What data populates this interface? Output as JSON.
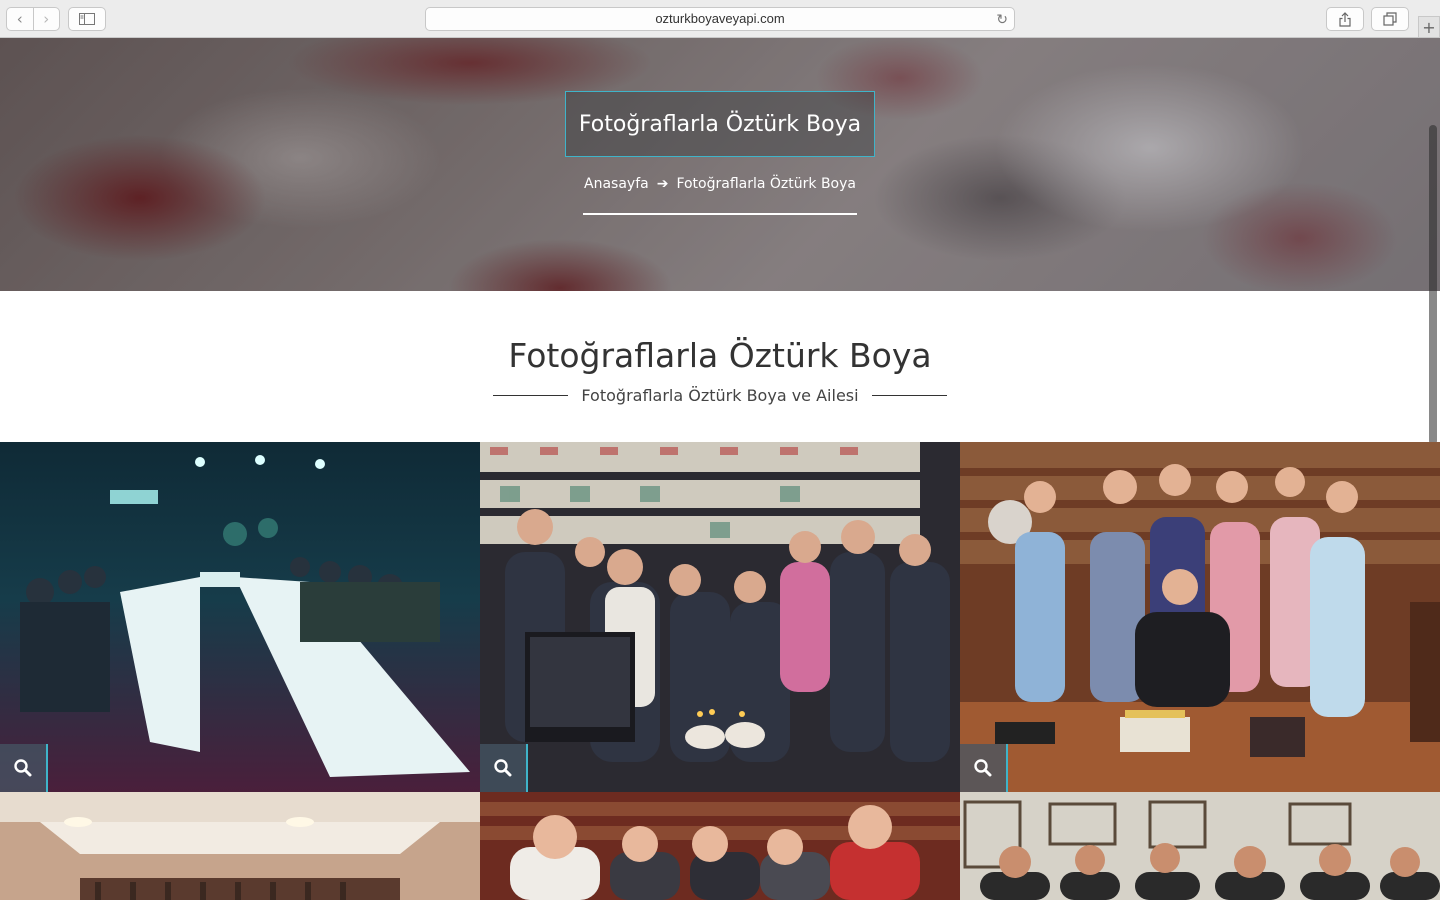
{
  "browser": {
    "url": "ozturkboyaveyapi.com"
  },
  "hero": {
    "title": "Fotoğraflarla Öztürk Boya",
    "breadcrumb_home": "Anasayfa",
    "breadcrumb_current": "Fotoğraflarla Öztürk Boya"
  },
  "section": {
    "title": "Fotoğraflarla Öztürk Boya",
    "subtitle": "Fotoğraflarla Öztürk Boya ve Ailesi"
  },
  "colors": {
    "accent": "#3fb4c9"
  },
  "gallery": {
    "photos": [
      {
        "name": "photo-banquet-table"
      },
      {
        "name": "photo-birthday-store"
      },
      {
        "name": "photo-office-group"
      },
      {
        "name": "photo-banquet-hall"
      },
      {
        "name": "photo-group-bookshelf"
      },
      {
        "name": "photo-group-office-wall"
      }
    ]
  }
}
